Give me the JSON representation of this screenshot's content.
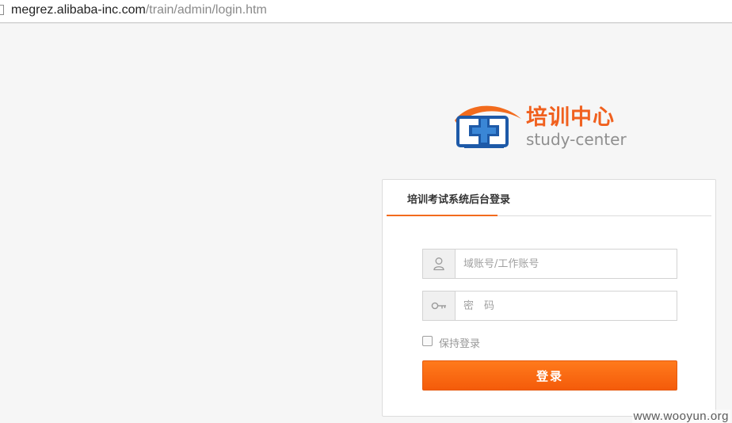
{
  "browser": {
    "url_host": "megrez.alibaba-inc.com",
    "url_path": "/train/admin/login.htm"
  },
  "logo": {
    "title": "培训中心",
    "subtitle": "study-center",
    "icon": "monitor-cross-icon"
  },
  "login": {
    "tab_title": "培训考试系统后台登录",
    "username_placeholder": "域账号/工作账号",
    "password_placeholder": "密　码",
    "username_icon": "user-icon",
    "password_icon": "key-icon",
    "remember_label": "保持登录",
    "remember_checked": false,
    "submit_label": "登录"
  },
  "watermark": "www.wooyun.org",
  "colors": {
    "accent": "#f26b1d",
    "button": "#f45b0a",
    "logo_blue": "#1e5aa8"
  }
}
